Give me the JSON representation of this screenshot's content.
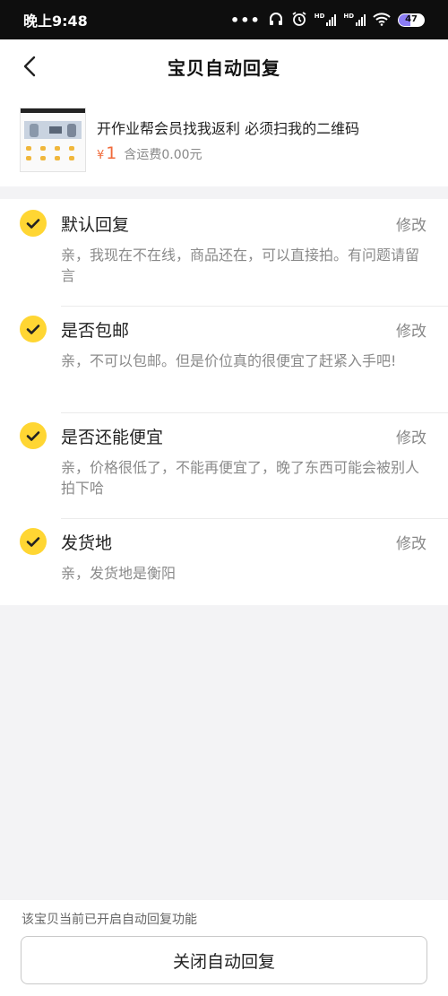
{
  "status_bar": {
    "time": "晚上9:48",
    "icons": [
      "more-dots-icon",
      "headphones-icon",
      "alarm-icon",
      "hd-signal-icon",
      "hd-signal-icon",
      "wifi-icon",
      "battery-icon"
    ],
    "hd_label": "HD",
    "battery": "47",
    "battery_level_percent": 47
  },
  "header": {
    "title": "宝贝自动回复",
    "back_icon": "back-arrow-icon"
  },
  "product": {
    "name": "开作业帮会员找我返利  必须扫我的二维码",
    "price_symbol": "¥",
    "price": "1",
    "shipping": "含运费0.00元"
  },
  "replies": [
    {
      "title": "默认回复",
      "content": "亲，我现在不在线，商品还在，可以直接拍。有问题请留言",
      "edit_label": "修改",
      "checked": true
    },
    {
      "title": "是否包邮",
      "content": "亲，不可以包邮。但是价位真的很便宜了赶紧入手吧!",
      "edit_label": "修改",
      "checked": true
    },
    {
      "title": "是否还能便宜",
      "content": "亲，价格很低了，不能再便宜了，晚了东西可能会被别人拍下哈",
      "edit_label": "修改",
      "checked": true
    },
    {
      "title": "发货地",
      "content": "亲，发货地是衡阳",
      "edit_label": "修改",
      "checked": true
    }
  ],
  "bottom": {
    "hint": "该宝贝当前已开启自动回复功能",
    "close_button": "关闭自动回复"
  },
  "colors": {
    "accent_yellow": "#ffd633",
    "price_orange": "#f06a3a",
    "status_bar_bg": "#0e0e0e",
    "page_bg": "#f3f3f5"
  }
}
